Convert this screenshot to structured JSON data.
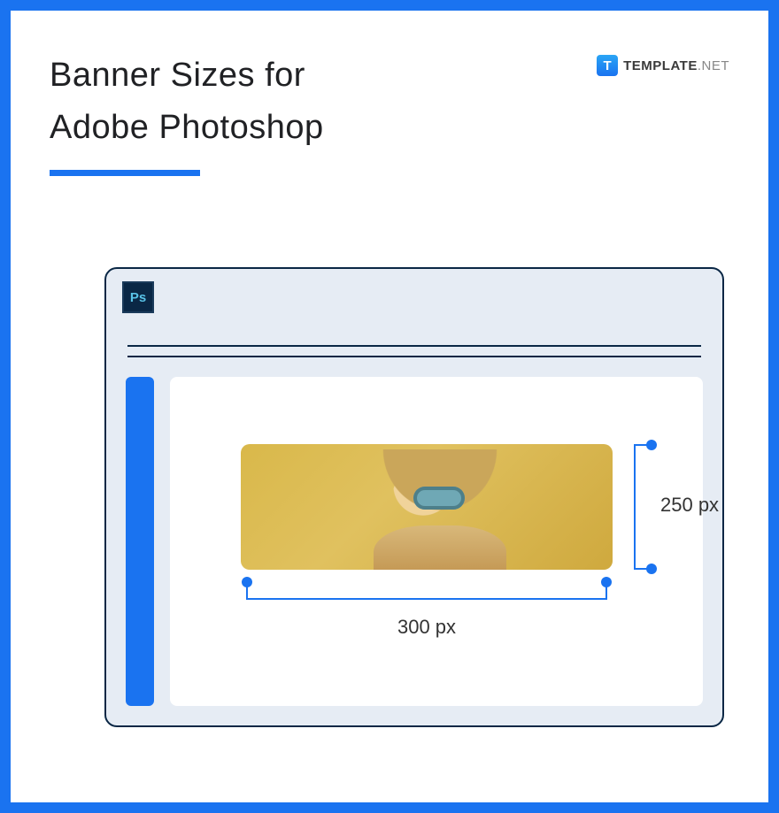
{
  "header": {
    "title_line1": "Banner Sizes for",
    "title_line2": "Adobe Photoshop"
  },
  "logo": {
    "badge_letter": "T",
    "brand_name": "TEMPLATE",
    "brand_ext": ".NET"
  },
  "app": {
    "ps_label": "Ps"
  },
  "dimensions": {
    "width_label": "300 px",
    "height_label": "250 px",
    "width_value": 300,
    "height_value": 250,
    "unit": "px"
  },
  "colors": {
    "accent": "#1a73f0",
    "frame_border": "#1a73f0",
    "window_border": "#0a2745",
    "window_bg": "#e6ecf4"
  }
}
